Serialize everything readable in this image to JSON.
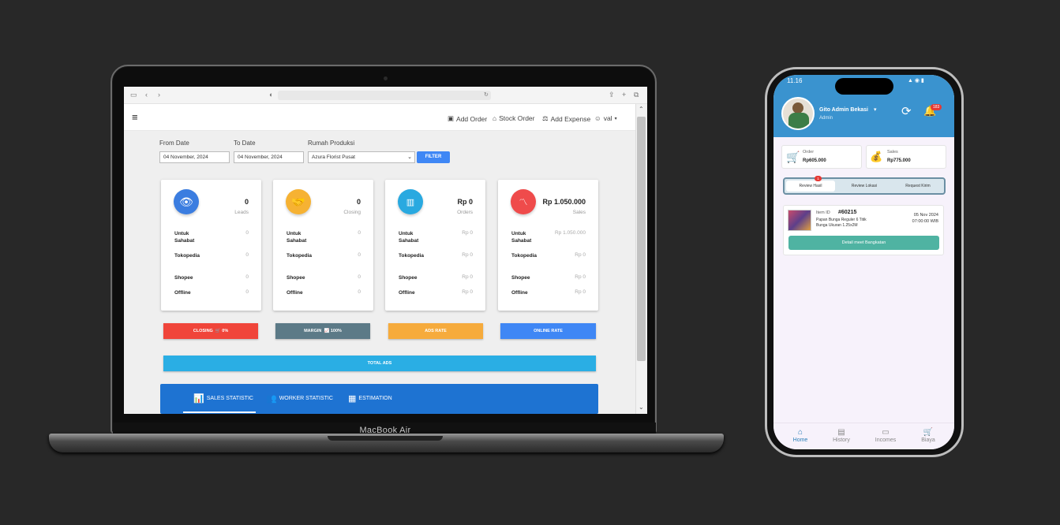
{
  "laptop": {
    "model_label": "MacBook Air",
    "header": {
      "menu_icon": "hamburger-icon",
      "add_order": "Add Order",
      "stock_order": "Stock Order",
      "add_expense": "Add Expense",
      "user": "val"
    },
    "filters": {
      "from_label": "From Date",
      "from_value": "04 November, 2024",
      "to_label": "To Date",
      "to_value": "04 November, 2024",
      "production_label": "Rumah Produksi",
      "production_value": "Azura Florist Pusat",
      "filter_button": "FILTER"
    },
    "cards": [
      {
        "value": "0",
        "label": "Leads",
        "color": "#3b7de0",
        "icon": "eye-icon",
        "rows": [
          {
            "l": "Untuk Sahabat",
            "v": "0"
          },
          {
            "l": "Tokopedia",
            "v": "0"
          },
          {
            "l": "Shopee",
            "v": "0"
          },
          {
            "l": "Offline",
            "v": "0"
          }
        ]
      },
      {
        "value": "0",
        "label": "Closing",
        "color": "#f6b233",
        "icon": "handshake-icon",
        "rows": [
          {
            "l": "Untuk Sahabat",
            "v": "0"
          },
          {
            "l": "Tokopedia",
            "v": "0"
          },
          {
            "l": "Shopee",
            "v": "0"
          },
          {
            "l": "Offline",
            "v": "0"
          }
        ]
      },
      {
        "value": "Rp 0",
        "label": "Orders",
        "color": "#29a9e0",
        "icon": "bar-chart-icon",
        "rows": [
          {
            "l": "Untuk Sahabat",
            "v": "Rp 0"
          },
          {
            "l": "Tokopedia",
            "v": "Rp 0"
          },
          {
            "l": "Shopee",
            "v": "Rp 0"
          },
          {
            "l": "Offline",
            "v": "Rp 0"
          }
        ]
      },
      {
        "value": "Rp 1.050.000",
        "label": "Sales",
        "color": "#ef4b4b",
        "icon": "line-chart-icon",
        "rows": [
          {
            "l": "Untuk Sahabat",
            "v": "Rp 1.050.000"
          },
          {
            "l": "Tokopedia",
            "v": "Rp 0"
          },
          {
            "l": "Shopee",
            "v": "Rp 0"
          },
          {
            "l": "Offline",
            "v": "Rp 0"
          }
        ]
      }
    ],
    "stat_buttons": [
      {
        "label": "CLOSING",
        "value": "0%",
        "icon": "cart-icon",
        "color": "#f0453a"
      },
      {
        "label": "MARGIN",
        "value": "100%",
        "icon": "chart-icon",
        "color": "#5c7a87"
      },
      {
        "label": "ADS RATE",
        "value": "",
        "icon": "",
        "color": "#f6ab3c"
      },
      {
        "label": "ONLINE RATE",
        "value": "",
        "icon": "",
        "color": "#3f87f5"
      }
    ],
    "total_ads": "TOTAL ADS",
    "total_ads_color": "#2aaee4",
    "tabs": [
      "SALES STATISTIC",
      "WORKER STATISTIC",
      "ESTIMATION"
    ]
  },
  "phone": {
    "time": "11.16",
    "user_name": "Gito Admin Bekasi",
    "user_role": "Admin",
    "notif_count": "183",
    "order_label": "Order",
    "order_value": "Rp605.000",
    "sales_label": "Sales",
    "sales_value": "Rp775.000",
    "segments": [
      "Review Hasil",
      "Review Lokasi",
      "Request Kirim"
    ],
    "segment_badge": "1",
    "item": {
      "id_label": "Item ID",
      "id_value": "#60215",
      "date": "05 Nov 2024",
      "time": "07:00:00 WIB",
      "desc_1": "Papan Bunga Reguler 6 Titik",
      "desc_2": "Bunga Ukuran 1.25x2M",
      "button": "Detail meet Bangkatan"
    },
    "nav": [
      "Home",
      "History",
      "Incomes",
      "Biaya"
    ]
  }
}
